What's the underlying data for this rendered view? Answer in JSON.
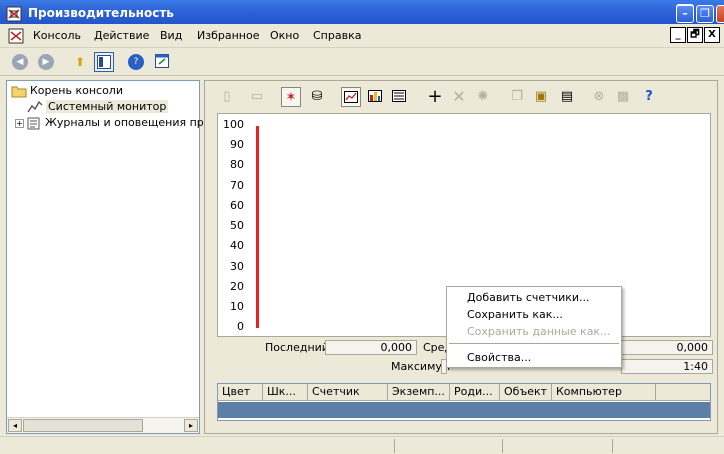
{
  "window": {
    "title": "Производительность",
    "app_icon": "mmc-console-icon"
  },
  "menubar": {
    "items": [
      "Консоль",
      "Действие",
      "Вид",
      "Избранное",
      "Окно",
      "Справка"
    ],
    "mdi_buttons": [
      "_",
      "🗗",
      "X"
    ]
  },
  "toolbar": {
    "icons": [
      "back-arrow-icon",
      "forward-arrow-icon",
      "up-folder-icon",
      "show-hide-tree-icon",
      "help-icon",
      "new-window-icon"
    ]
  },
  "tree": {
    "items": [
      {
        "label": "Корень консоли",
        "icon": "folder-icon"
      },
      {
        "label": "Системный монитор",
        "icon": "system-monitor-icon",
        "selected": true
      },
      {
        "label": "Журналы и оповещения прои",
        "icon": "logs-alerts-icon",
        "expand": "+"
      }
    ]
  },
  "monitor_toolbar": {
    "icons": [
      "new-counter-set-icon",
      "clear-display-icon",
      "view-current-activity-icon",
      "view-log-data-icon",
      "view-graph-icon",
      "view-histogram-icon",
      "view-report-icon",
      "add-icon",
      "delete-icon",
      "highlight-icon",
      "copy-properties-icon",
      "paste-counter-list-icon",
      "properties-icon",
      "freeze-display-icon",
      "update-data-icon",
      "help-icon"
    ]
  },
  "graph": {
    "y_labels": [
      "100",
      "90",
      "80",
      "70",
      "60",
      "50",
      "40",
      "30",
      "20",
      "10",
      "0"
    ],
    "line_color": "#E52121"
  },
  "stats": {
    "last_label": "Последний",
    "last_value": "0,000",
    "avg_label_partial": "Сред",
    "right_value": "0,000",
    "max_label": "Максимум",
    "duration_value": "1:40"
  },
  "legend": {
    "columns": [
      "Цвет",
      "Шк...",
      "Счетчик",
      "Экземп...",
      "Роди...",
      "Объект",
      "Компьютер"
    ]
  },
  "context_menu": {
    "items": [
      {
        "label": "Добавить счетчики...",
        "enabled": true
      },
      {
        "label": "Сохранить как...",
        "enabled": true
      },
      {
        "label": "Сохранить данные как...",
        "enabled": false
      },
      {
        "label": "Свойства...",
        "enabled": true
      }
    ]
  }
}
